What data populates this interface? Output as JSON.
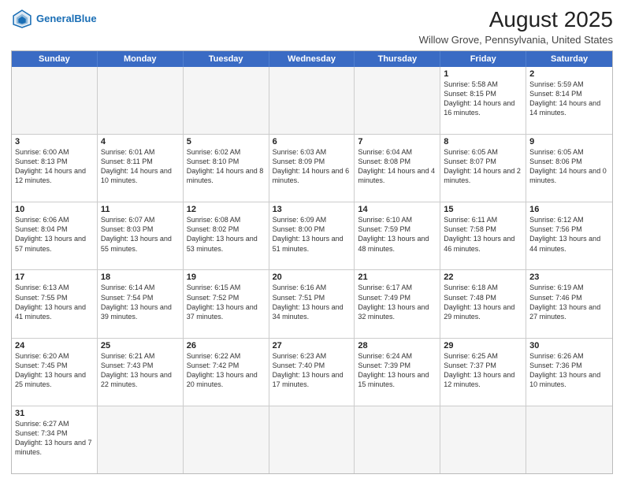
{
  "header": {
    "logo_general": "General",
    "logo_blue": "Blue",
    "title": "August 2025",
    "subtitle": "Willow Grove, Pennsylvania, United States"
  },
  "days_of_week": [
    "Sunday",
    "Monday",
    "Tuesday",
    "Wednesday",
    "Thursday",
    "Friday",
    "Saturday"
  ],
  "rows": [
    [
      {
        "day": "",
        "text": "",
        "empty": true
      },
      {
        "day": "",
        "text": "",
        "empty": true
      },
      {
        "day": "",
        "text": "",
        "empty": true
      },
      {
        "day": "",
        "text": "",
        "empty": true
      },
      {
        "day": "",
        "text": "",
        "empty": true
      },
      {
        "day": "1",
        "text": "Sunrise: 5:58 AM\nSunset: 8:15 PM\nDaylight: 14 hours and 16 minutes.",
        "empty": false
      },
      {
        "day": "2",
        "text": "Sunrise: 5:59 AM\nSunset: 8:14 PM\nDaylight: 14 hours and 14 minutes.",
        "empty": false
      }
    ],
    [
      {
        "day": "3",
        "text": "Sunrise: 6:00 AM\nSunset: 8:13 PM\nDaylight: 14 hours and 12 minutes.",
        "empty": false
      },
      {
        "day": "4",
        "text": "Sunrise: 6:01 AM\nSunset: 8:11 PM\nDaylight: 14 hours and 10 minutes.",
        "empty": false
      },
      {
        "day": "5",
        "text": "Sunrise: 6:02 AM\nSunset: 8:10 PM\nDaylight: 14 hours and 8 minutes.",
        "empty": false
      },
      {
        "day": "6",
        "text": "Sunrise: 6:03 AM\nSunset: 8:09 PM\nDaylight: 14 hours and 6 minutes.",
        "empty": false
      },
      {
        "day": "7",
        "text": "Sunrise: 6:04 AM\nSunset: 8:08 PM\nDaylight: 14 hours and 4 minutes.",
        "empty": false
      },
      {
        "day": "8",
        "text": "Sunrise: 6:05 AM\nSunset: 8:07 PM\nDaylight: 14 hours and 2 minutes.",
        "empty": false
      },
      {
        "day": "9",
        "text": "Sunrise: 6:05 AM\nSunset: 8:06 PM\nDaylight: 14 hours and 0 minutes.",
        "empty": false
      }
    ],
    [
      {
        "day": "10",
        "text": "Sunrise: 6:06 AM\nSunset: 8:04 PM\nDaylight: 13 hours and 57 minutes.",
        "empty": false
      },
      {
        "day": "11",
        "text": "Sunrise: 6:07 AM\nSunset: 8:03 PM\nDaylight: 13 hours and 55 minutes.",
        "empty": false
      },
      {
        "day": "12",
        "text": "Sunrise: 6:08 AM\nSunset: 8:02 PM\nDaylight: 13 hours and 53 minutes.",
        "empty": false
      },
      {
        "day": "13",
        "text": "Sunrise: 6:09 AM\nSunset: 8:00 PM\nDaylight: 13 hours and 51 minutes.",
        "empty": false
      },
      {
        "day": "14",
        "text": "Sunrise: 6:10 AM\nSunset: 7:59 PM\nDaylight: 13 hours and 48 minutes.",
        "empty": false
      },
      {
        "day": "15",
        "text": "Sunrise: 6:11 AM\nSunset: 7:58 PM\nDaylight: 13 hours and 46 minutes.",
        "empty": false
      },
      {
        "day": "16",
        "text": "Sunrise: 6:12 AM\nSunset: 7:56 PM\nDaylight: 13 hours and 44 minutes.",
        "empty": false
      }
    ],
    [
      {
        "day": "17",
        "text": "Sunrise: 6:13 AM\nSunset: 7:55 PM\nDaylight: 13 hours and 41 minutes.",
        "empty": false
      },
      {
        "day": "18",
        "text": "Sunrise: 6:14 AM\nSunset: 7:54 PM\nDaylight: 13 hours and 39 minutes.",
        "empty": false
      },
      {
        "day": "19",
        "text": "Sunrise: 6:15 AM\nSunset: 7:52 PM\nDaylight: 13 hours and 37 minutes.",
        "empty": false
      },
      {
        "day": "20",
        "text": "Sunrise: 6:16 AM\nSunset: 7:51 PM\nDaylight: 13 hours and 34 minutes.",
        "empty": false
      },
      {
        "day": "21",
        "text": "Sunrise: 6:17 AM\nSunset: 7:49 PM\nDaylight: 13 hours and 32 minutes.",
        "empty": false
      },
      {
        "day": "22",
        "text": "Sunrise: 6:18 AM\nSunset: 7:48 PM\nDaylight: 13 hours and 29 minutes.",
        "empty": false
      },
      {
        "day": "23",
        "text": "Sunrise: 6:19 AM\nSunset: 7:46 PM\nDaylight: 13 hours and 27 minutes.",
        "empty": false
      }
    ],
    [
      {
        "day": "24",
        "text": "Sunrise: 6:20 AM\nSunset: 7:45 PM\nDaylight: 13 hours and 25 minutes.",
        "empty": false
      },
      {
        "day": "25",
        "text": "Sunrise: 6:21 AM\nSunset: 7:43 PM\nDaylight: 13 hours and 22 minutes.",
        "empty": false
      },
      {
        "day": "26",
        "text": "Sunrise: 6:22 AM\nSunset: 7:42 PM\nDaylight: 13 hours and 20 minutes.",
        "empty": false
      },
      {
        "day": "27",
        "text": "Sunrise: 6:23 AM\nSunset: 7:40 PM\nDaylight: 13 hours and 17 minutes.",
        "empty": false
      },
      {
        "day": "28",
        "text": "Sunrise: 6:24 AM\nSunset: 7:39 PM\nDaylight: 13 hours and 15 minutes.",
        "empty": false
      },
      {
        "day": "29",
        "text": "Sunrise: 6:25 AM\nSunset: 7:37 PM\nDaylight: 13 hours and 12 minutes.",
        "empty": false
      },
      {
        "day": "30",
        "text": "Sunrise: 6:26 AM\nSunset: 7:36 PM\nDaylight: 13 hours and 10 minutes.",
        "empty": false
      }
    ],
    [
      {
        "day": "31",
        "text": "Sunrise: 6:27 AM\nSunset: 7:34 PM\nDaylight: 13 hours and 7 minutes.",
        "empty": false
      },
      {
        "day": "",
        "text": "",
        "empty": true
      },
      {
        "day": "",
        "text": "",
        "empty": true
      },
      {
        "day": "",
        "text": "",
        "empty": true
      },
      {
        "day": "",
        "text": "",
        "empty": true
      },
      {
        "day": "",
        "text": "",
        "empty": true
      },
      {
        "day": "",
        "text": "",
        "empty": true
      }
    ]
  ]
}
